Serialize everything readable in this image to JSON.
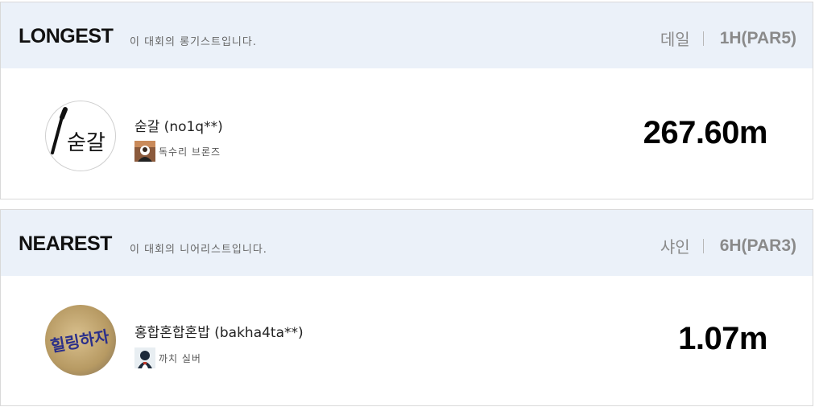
{
  "longest": {
    "title": "LONGEST",
    "description": "이 대회의 롱기스트입니다.",
    "course": "데일",
    "hole": "1H(PAR5)",
    "player_name": "숟갈 (no1q**)",
    "avatar_text": "숟갈",
    "grade_label": "독수리 브론즈",
    "grade_icon": "eagle-bronze-icon",
    "distance": "267.60m"
  },
  "nearest": {
    "title": "NEAREST",
    "description": "이 대회의 니어리스트입니다.",
    "course": "샤인",
    "hole": "6H(PAR3)",
    "player_name": "홍합혼합혼밥 (bakha4ta**)",
    "avatar_text": "힐링하자",
    "grade_label": "까치 실버",
    "grade_icon": "magpie-silver-icon",
    "distance": "1.07m"
  }
}
